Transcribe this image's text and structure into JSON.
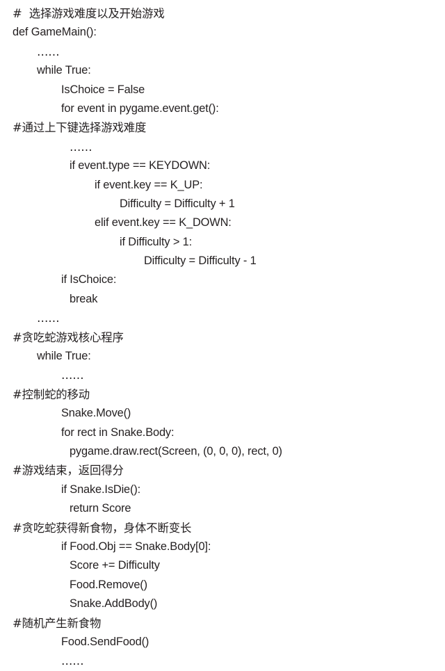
{
  "document": {
    "kind": "code-listing",
    "language": "Python",
    "background_color": "#ffffff",
    "text_color": "#231f20"
  },
  "code": {
    "lines": [
      {
        "indent": 0,
        "text": "#  选择游戏难度以及开始游戏",
        "is_comment": true,
        "has_cjk": true
      },
      {
        "indent": 0,
        "text": "def GameMain():",
        "is_comment": false,
        "has_cjk": false
      },
      {
        "indent": 1,
        "text": "……",
        "is_comment": false,
        "has_cjk": true
      },
      {
        "indent": 1,
        "text": "while True:",
        "is_comment": false,
        "has_cjk": false
      },
      {
        "indent": 2,
        "text": "IsChoice = False",
        "is_comment": false,
        "has_cjk": false
      },
      {
        "indent": 2,
        "text": "for event in pygame.event.get():",
        "is_comment": false,
        "has_cjk": false
      },
      {
        "indent": 0,
        "text": "#通过上下键选择游戏难度",
        "is_comment": true,
        "has_cjk": true
      },
      {
        "indent": 3,
        "text": "……",
        "is_comment": false,
        "has_cjk": true
      },
      {
        "indent": 3,
        "text": "if event.type == KEYDOWN:",
        "is_comment": false,
        "has_cjk": false
      },
      {
        "indent": 4,
        "text": "if event.key == K_UP:",
        "is_comment": false,
        "has_cjk": false
      },
      {
        "indent": 5,
        "text": "Difficulty = Difficulty + 1",
        "is_comment": false,
        "has_cjk": false
      },
      {
        "indent": 4,
        "text": "elif event.key == K_DOWN:",
        "is_comment": false,
        "has_cjk": false
      },
      {
        "indent": 5,
        "text": "if Difficulty > 1:",
        "is_comment": false,
        "has_cjk": false
      },
      {
        "indent": 6,
        "text": "Difficulty = Difficulty - 1",
        "is_comment": false,
        "has_cjk": false
      },
      {
        "indent": 2,
        "text": "if IsChoice:",
        "is_comment": false,
        "has_cjk": false
      },
      {
        "indent": 3,
        "text": "break",
        "is_comment": false,
        "has_cjk": false
      },
      {
        "indent": 1,
        "text": "……",
        "is_comment": false,
        "has_cjk": true
      },
      {
        "indent": 0,
        "text": "#贪吃蛇游戏核心程序",
        "is_comment": true,
        "has_cjk": true
      },
      {
        "indent": 1,
        "text": "while True:",
        "is_comment": false,
        "has_cjk": false
      },
      {
        "indent": 2,
        "text": "……",
        "is_comment": false,
        "has_cjk": true
      },
      {
        "indent": 0,
        "text": "#控制蛇的移动",
        "is_comment": true,
        "has_cjk": true
      },
      {
        "indent": 2,
        "text": "Snake.Move()",
        "is_comment": false,
        "has_cjk": false
      },
      {
        "indent": 2,
        "text": "for rect in Snake.Body:",
        "is_comment": false,
        "has_cjk": false
      },
      {
        "indent": 3,
        "text": "pygame.draw.rect(Screen, (0, 0, 0), rect, 0)",
        "is_comment": false,
        "has_cjk": false
      },
      {
        "indent": 0,
        "text": "#游戏结束，返回得分",
        "is_comment": true,
        "has_cjk": true
      },
      {
        "indent": 2,
        "text": "if Snake.IsDie():",
        "is_comment": false,
        "has_cjk": false
      },
      {
        "indent": 3,
        "text": "return Score",
        "is_comment": false,
        "has_cjk": false
      },
      {
        "indent": 0,
        "text": "#贪吃蛇获得新食物，身体不断变长",
        "is_comment": true,
        "has_cjk": true
      },
      {
        "indent": 2,
        "text": "if Food.Obj == Snake.Body[0]:",
        "is_comment": false,
        "has_cjk": false
      },
      {
        "indent": 3,
        "text": "Score += Difficulty",
        "is_comment": false,
        "has_cjk": false
      },
      {
        "indent": 3,
        "text": "Food.Remove()",
        "is_comment": false,
        "has_cjk": false
      },
      {
        "indent": 3,
        "text": "Snake.AddBody()",
        "is_comment": false,
        "has_cjk": false
      },
      {
        "indent": 0,
        "text": "#随机产生新食物",
        "is_comment": true,
        "has_cjk": true
      },
      {
        "indent": 2,
        "text": "Food.SendFood()",
        "is_comment": false,
        "has_cjk": false
      },
      {
        "indent": 2,
        "text": "……",
        "is_comment": false,
        "has_cjk": true
      }
    ]
  }
}
